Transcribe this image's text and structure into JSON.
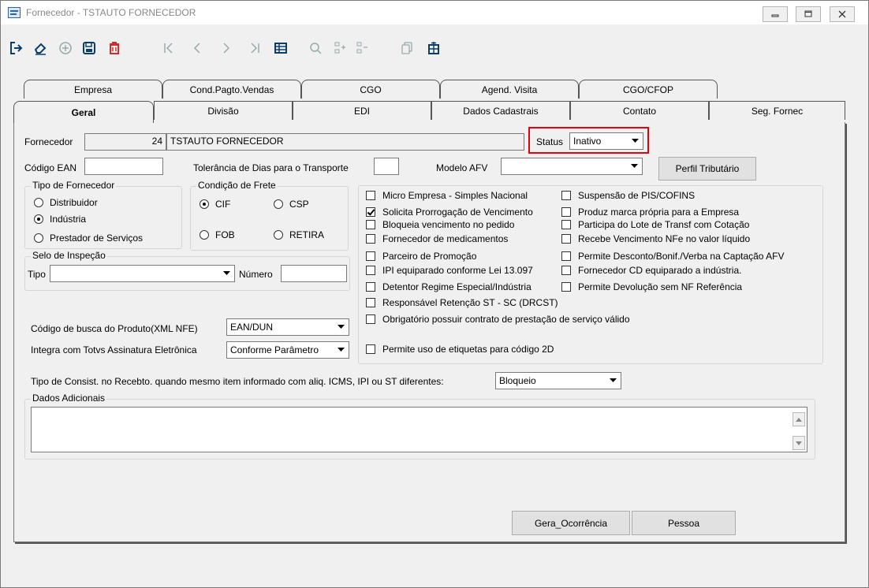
{
  "window": {
    "title": "Fornecedor - TSTAUTO FORNECEDOR"
  },
  "icons": [
    "app-icon",
    "exit-icon",
    "eraser-icon",
    "add-circle-icon",
    "save-icon",
    "delete-icon",
    "first-record-icon",
    "previous-record-icon",
    "next-record-icon",
    "last-record-icon",
    "grid-icon",
    "search-icon",
    "add-list-icon",
    "remove-list-icon",
    "copy-icon",
    "calculator-icon",
    "dropdown-arrow-icon",
    "scroll-up-icon",
    "scroll-down-icon"
  ],
  "tabs": {
    "back": [
      "Empresa",
      "Cond.Pagto.Vendas",
      "CGO",
      "Agend. Visita",
      "CGO/CFOP"
    ],
    "front": [
      "Geral",
      "Divisão",
      "EDI",
      "Dados Cadastrais",
      "Contato",
      "Seg. Fornec"
    ],
    "active": "Geral"
  },
  "form": {
    "fornecedor_label": "Fornecedor",
    "fornecedor_code": "24",
    "fornecedor_name": "TSTAUTO FORNECEDOR",
    "status_label": "Status",
    "status_value": "Inativo",
    "ean_label": "Código EAN",
    "ean_value": "",
    "tolerancia_label": "Tolerância de Dias para o Transporte",
    "tolerancia_value": "",
    "modelo_afv_label": "Modelo AFV",
    "modelo_afv_value": "",
    "perfil_button": "Perfil Tributário"
  },
  "tipo_fornecedor": {
    "title": "Tipo de Fornecedor",
    "options": [
      {
        "label": "Distribuidor",
        "checked": false
      },
      {
        "label": "Indústria",
        "checked": true
      },
      {
        "label": "Prestador de Serviços",
        "checked": false
      }
    ]
  },
  "condicao_frete": {
    "title": "Condição de Frete",
    "options": [
      {
        "label": "CIF",
        "checked": true
      },
      {
        "label": "CSP",
        "checked": false
      },
      {
        "label": "FOB",
        "checked": false
      },
      {
        "label": "RETIRA",
        "checked": false
      }
    ]
  },
  "selo_inspecao": {
    "title": "Selo de Inspeção",
    "tipo_label": "Tipo",
    "tipo_value": "",
    "numero_label": "Número",
    "numero_value": ""
  },
  "checkboxes_left": [
    {
      "label": "Micro Empresa - Simples Nacional",
      "checked": false
    },
    {
      "label": "Solicita Prorrogação de Vencimento",
      "checked": true
    },
    {
      "label": "Bloqueia vencimento no pedido",
      "checked": false
    },
    {
      "label": "Fornecedor de medicamentos",
      "checked": false
    },
    {
      "label": "Parceiro de Promoção",
      "checked": false
    },
    {
      "label": "IPI equiparado conforme Lei 13.097",
      "checked": false
    },
    {
      "label": "Detentor Regime Especial/Indústria",
      "checked": false
    },
    {
      "label": "Responsável Retenção ST - SC (DRCST)",
      "checked": false
    },
    {
      "label": "Obrigatório possuir contrato de prestação de serviço válido",
      "checked": false
    },
    {
      "label": "Permite uso de etiquetas para código 2D",
      "checked": false
    }
  ],
  "checkboxes_right": [
    {
      "label": "Suspensão de PIS/COFINS",
      "checked": false
    },
    {
      "label": "Produz marca própria para a Empresa",
      "checked": false
    },
    {
      "label": "Participa do Lote de Transf com Cotação",
      "checked": false
    },
    {
      "label": "Recebe Vencimento NFe no valor líquido",
      "checked": false
    },
    {
      "label": "Permite Desconto/Bonif./Verba na Captação AFV",
      "checked": false
    },
    {
      "label": "Fornecedor CD equiparado a indústria.",
      "checked": false
    },
    {
      "label": "Permite Devolução sem NF Referência",
      "checked": false
    }
  ],
  "busca": {
    "codigo_label": "Código de busca do Produto(XML NFE)",
    "codigo_value": "EAN/DUN",
    "integra_label": "Integra com Totvs Assinatura Eletrônica",
    "integra_value": "Conforme Parâmetro"
  },
  "consist": {
    "label": "Tipo de Consist. no Recebto. quando mesmo item informado com aliq. ICMS, IPI ou ST diferentes:",
    "value": "Bloqueio"
  },
  "dados_adicionais": {
    "title": "Dados Adicionais",
    "value": ""
  },
  "buttons": {
    "gera_ocorrencia": "Gera_Ocorrência",
    "pessoa": "Pessoa"
  },
  "colors": {
    "highlight": "#e3000b",
    "delete_icon": "#d42a2a",
    "toolbar_icon": "#0a3d6b"
  }
}
